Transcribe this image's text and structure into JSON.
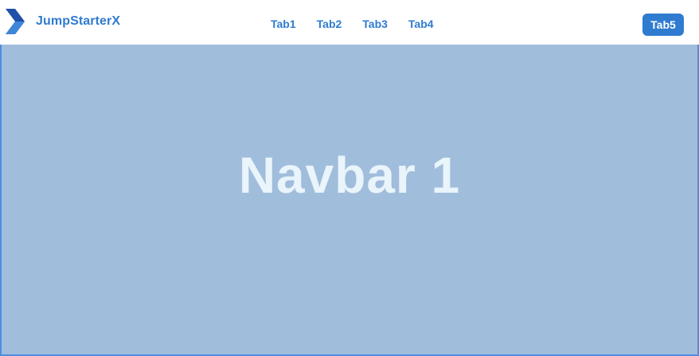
{
  "navbar": {
    "brand": {
      "logo_icon": "chevron-logo-icon",
      "name": "JumpStarterX"
    },
    "links": [
      {
        "label": "Tab1"
      },
      {
        "label": "Tab2"
      },
      {
        "label": "Tab3"
      },
      {
        "label": "Tab4"
      }
    ],
    "cta_label": "Tab5"
  },
  "hero": {
    "title": "Navbar 1"
  },
  "colors": {
    "accent": "#2f7bd0",
    "hero_background": "#a1bddc",
    "hero_border": "#4f8de0",
    "hero_text": "#e9f4fb"
  }
}
